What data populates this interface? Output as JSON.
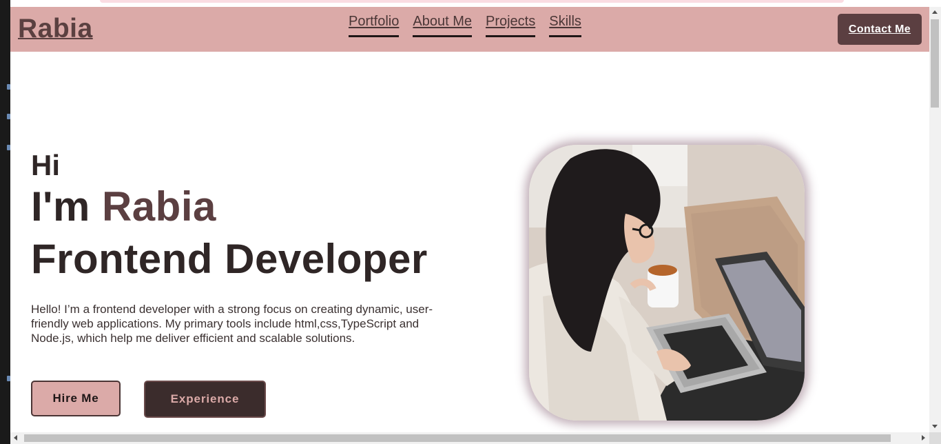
{
  "navbar": {
    "logo": "Rabia",
    "links": [
      "Portfolio",
      "About Me",
      "Projects",
      "Skills"
    ],
    "contact_label": "Contact Me"
  },
  "hero": {
    "greeting": "Hi",
    "intro_prefix": "I'm",
    "name": "Rabia",
    "role": "Frontend Developer",
    "bio": "Hello! I’m a frontend developer with a strong focus on creating dynamic, user-friendly web applications. My primary tools include html,css,TypeScript and Node.js, which help me deliver efficient and scalable solutions.",
    "hire_label": "Hire Me",
    "experience_label": "Experience"
  },
  "colors": {
    "navbar_bg": "#dbaaa8",
    "accent_dark": "#5b3f41",
    "text_dark": "#2f2626",
    "button_dark": "#3b2c2c"
  },
  "icons": {
    "scroll_up": "arrow-up-icon",
    "scroll_down": "arrow-down-icon",
    "scroll_left": "arrow-left-icon",
    "scroll_right": "arrow-right-icon"
  }
}
